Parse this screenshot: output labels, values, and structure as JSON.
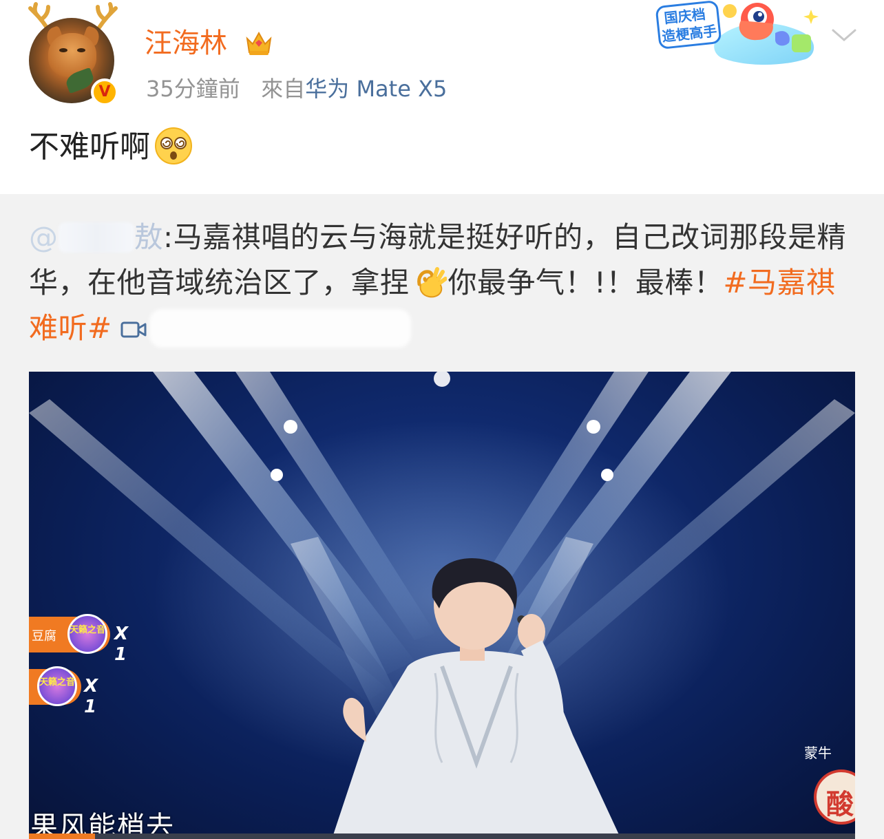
{
  "author": {
    "name": "汪海林",
    "verified_mark": "V",
    "time": "35分鐘前",
    "source_prefix": "來自",
    "device": "华为 Mate X5"
  },
  "badge": {
    "line1": "国庆档",
    "line2": "造梗高手"
  },
  "post": {
    "text": "不难听啊",
    "emoji": "dizzy-face-icon"
  },
  "repost": {
    "mention_prefix": "@",
    "mention_tail": "敖",
    "body_part1": ":马嘉祺唱的云与海就是挺好听的，自己改词那段是精华，在他音域统治区了，拿捏",
    "body_part2": "你最争气！!！最棒！",
    "hashtag": "#马嘉祺 难听#"
  },
  "video": {
    "gift1_label": "豆腐",
    "gift_badge_text": "天籁之音",
    "gift1_count": "X 1",
    "gift2_count": "X 1",
    "watermark": "蒙牛",
    "show_logo": "酸",
    "subtitle": "果风能梢去",
    "progress": 0.08
  },
  "colors": {
    "accent": "#f26b1f",
    "link": "#4a6f9c",
    "repost_bg": "#f2f2f2"
  }
}
